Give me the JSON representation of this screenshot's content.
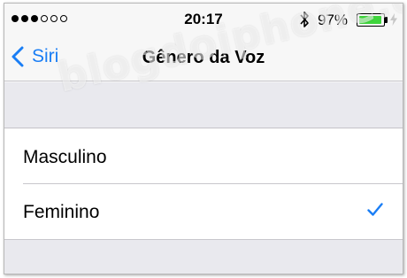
{
  "status_bar": {
    "signal_strength": {
      "filled": 3,
      "total": 6
    },
    "time": "20:17",
    "bluetooth_icon": "bluetooth-icon",
    "battery_percent": "97%",
    "battery_level": 0.97,
    "charging_icon": "lightning-bolt-icon"
  },
  "nav": {
    "back_label": "Siri",
    "back_icon": "chevron-left-icon",
    "title": "Gênero da Voz"
  },
  "options": [
    {
      "label": "Masculino",
      "selected": false
    },
    {
      "label": "Feminino",
      "selected": true
    }
  ],
  "watermark": "blogdoiphone.com",
  "colors": {
    "accent": "#1a7ef5",
    "battery": "#3fd53c",
    "grouped_background": "#e9e9ee",
    "separator": "#c8c7cc"
  }
}
